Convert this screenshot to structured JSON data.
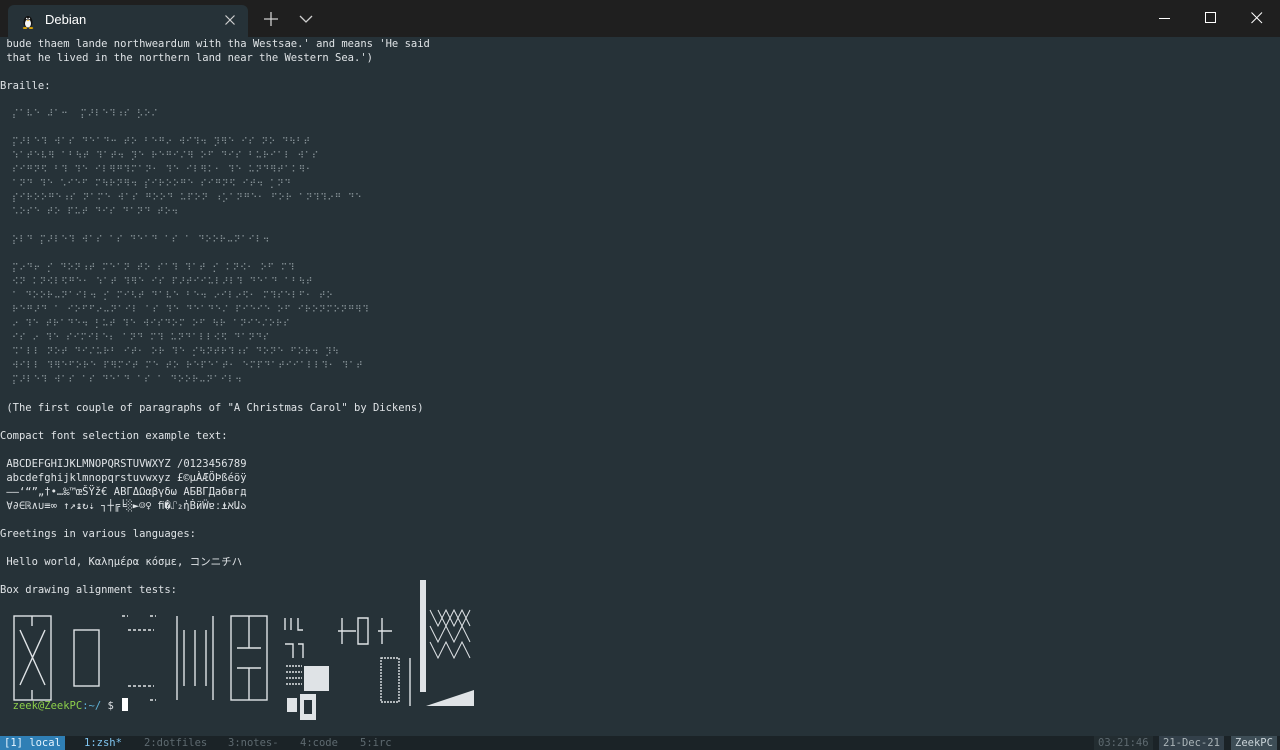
{
  "titlebar": {
    "tab_title": "Debian",
    "tab_icon": "penguin-icon"
  },
  "terminal": {
    "lines": {
      "l0": " bude thaem lande northweardum with tha Westsae.' and means 'He said",
      "l1": " that he lived in the northern land near the Western Sea.')",
      "l2": "Braille:",
      "b0": "⡌⠁⠧⠑ ⠼⠁⠒  ⡍⠜⠇⠑⠹⠰⠎ ⡣⠕⠌",
      "b1": "⡍⠜⠇⠑⠹ ⠺⠁⠎ ⠙⠑⠁⠙⠒ ⠞⠕ ⠃⠑⠛⠔ ⠺⠊⠹⠲ ⡹⠻⠑ ⠊⠎ ⠝⠕ ⠙⠳⠃⠞",
      "b2": "⠱⠁⠞⠑⠧⠻ ⠁⠃⠳⠞ ⠹⠁⠞⠲ ⡹⠑ ⠗⠑⠛⠊⠌⠻ ⠕⠋ ⠙⠊⠎ ⠃⠥⠗⠊⠁⠇ ⠺⠁⠎",
      "b3": "⠎⠊⠛⠝⠫ ⠃⠹ ⠹⠑ ⠊⠇⠻⠛⠹⠍⠁⠝⠂ ⠹⠑ ⠊⠇⠻⠅⠂ ⠹⠑ ⠥⠝⠙⠻⠞⠁⠅⠻⠂",
      "b4": "⠁⠝⠙ ⠹⠑ ⠡⠊⠑⠋ ⠍⠳⠗⠝⠻⠲ ⡎⠊⠗⠕⠕⠛⠑ ⠎⠊⠛⠝⠫ ⠊⠞⠲ ⡁⠝⠙",
      "b5": "⡎⠊⠗⠕⠕⠛⠑⠰⠎ ⠝⠁⠍⠑ ⠺⠁⠎ ⠛⠕⠕⠙ ⠥⠏⠕⠝ ⠰⡡⠁⠝⠛⠑⠂ ⠋⠕⠗ ⠁⠝⠹⠹⠔⠛ ⠙⠑",
      "b6": "⠡⠕⠎⠑ ⠞⠕ ⠏⠥⠞ ⠙⠊⠎ ⠙⠁⠝⠙ ⠞⠕⠲",
      "b7": "⡕⠇⠙ ⡍⠜⠇⠑⠹ ⠺⠁⠎ ⠁⠎ ⠙⠑⠁⠙ ⠁⠎ ⠁ ⠙⠕⠕⠗⠤⠝⠁⠊⠇⠲",
      "b8": "⡍⠔⠙⠖ ⡊ ⠙⠕⠝⠰⠞ ⠍⠑⠁⠝ ⠞⠕ ⠎⠁⠹ ⠹⠁⠞ ⡊ ⠅⠝⠪⠂ ⠕⠋ ⠍⠹",
      "b9": "⠪⠝ ⠅⠝⠪⠇⠫⠛⠑⠂ ⠱⠁⠞ ⠹⠻⠑ ⠊⠎ ⠏⠜⠞⠊⠊⠥⠇⠜⠇⠹ ⠙⠑⠁⠙ ⠁⠃⠳⠞",
      "b10": "⠁ ⠙⠕⠕⠗⠤⠝⠁⠊⠇⠲ ⡊ ⠍⠊⠣⠞ ⠙⠁⠧⠑ ⠃⠑⠲ ⠔⠊⠇⠔⠫⠂ ⠍⠹⠎⠑⠇⠋⠂ ⠞⠕",
      "b11": "⠗⠑⠛⠜⠙ ⠁ ⠊⠕⠋⠋⠔⠤⠝⠁⠊⠇ ⠁⠎ ⠹⠑ ⠙⠑⠁⠙⠑⠌ ⠏⠊⠑⠊⠑ ⠕⠋ ⠊⠗⠕⠝⠍⠕⠝⠛⠻⠹",
      "b12": "⠔ ⠹⠑ ⠞⠗⠁⠙⠑⠲ ⡃⠥⠞ ⠹⠑ ⠺⠊⠎⠙⠕⠍ ⠕⠋ ⠳⠗ ⠁⠝⠊⠑⠌⠕⠗⠎",
      "b13": "⠊⠎ ⠔ ⠹⠑ ⠎⠊⠍⠊⠇⠑⠆ ⠁⠝⠙ ⠍⠹ ⠥⠝⠙⠁⠇⠇⠪⠫ ⠙⠁⠝⠙⠎",
      "b14": "⠩⠁⠇⠇ ⠝⠕⠞ ⠙⠊⠌⠥⠗⠃ ⠊⠞⠂ ⠕⠗ ⠹⠑ ⡊⠳⠝⠞⠗⠹⠰⠎ ⠙⠕⠝⠑ ⠋⠕⠗⠲ ⡹⠳",
      "b15": "⠺⠊⠇⠇ ⠹⠻⠑⠋⠕⠗⠑ ⠏⠻⠍⠊⠞ ⠍⠑ ⠞⠕ ⠗⠑⠏⠑⠁⠞⠂ ⠑⠍⠏⠙⠁⠞⠊⠊⠁⠇⠇⠹⠂ ⠹⠁⠞",
      "b16": "⡍⠜⠇⠑⠹ ⠺⠁⠎ ⠁⠎ ⠙⠑⠁⠙ ⠁⠎ ⠁ ⠙⠕⠕⠗⠤⠝⠁⠊⠇⠲",
      "l3": " (The first couple of paragraphs of \"A Christmas Carol\" by Dickens)",
      "l4": "Compact font selection example text:",
      "c0": " ABCDEFGHIJKLMNOPQRSTUVWXYZ /0123456789",
      "c1": " abcdefghijklmnopqrstuvwxyz £©µÀÆÖÞßéöÿ",
      "c2": " –—‘“”„†•…‰™œŠŸž€ ΑΒΓΔΩαβγδω АБВГДабвгд",
      "c3": " ∀∂∈ℝ∧∪≡∞ ↑↗↨↻⇣ ┐┼╔╘░►☺♀ ﬁ�⑀₂ἠḂӥẄɐː⍎אԱა",
      "l5": "Greetings in various languages:",
      "g0": " Hello world, Καλημέρα κόσμε, コンニチハ",
      "l6": "Box drawing alignment tests:"
    },
    "prompt": {
      "user_host": "zeek@ZeekPC",
      "path": ":~/",
      "symbol": " $ "
    }
  },
  "statusbar": {
    "session": "[1] local",
    "windows": [
      "1:zsh*",
      "2:dotfiles",
      "3:notes-",
      "4:code",
      "5:irc"
    ],
    "time": "03:21:46",
    "date": "21-Dec-21",
    "host": "ZeekPC"
  },
  "colors": {
    "terminal_bg": "#263238",
    "titlebar_bg": "#1f1f1f",
    "prompt_user": "#8ccf4a",
    "prompt_path": "#5fb3d9",
    "status_session_bg": "#2f7fb5"
  }
}
